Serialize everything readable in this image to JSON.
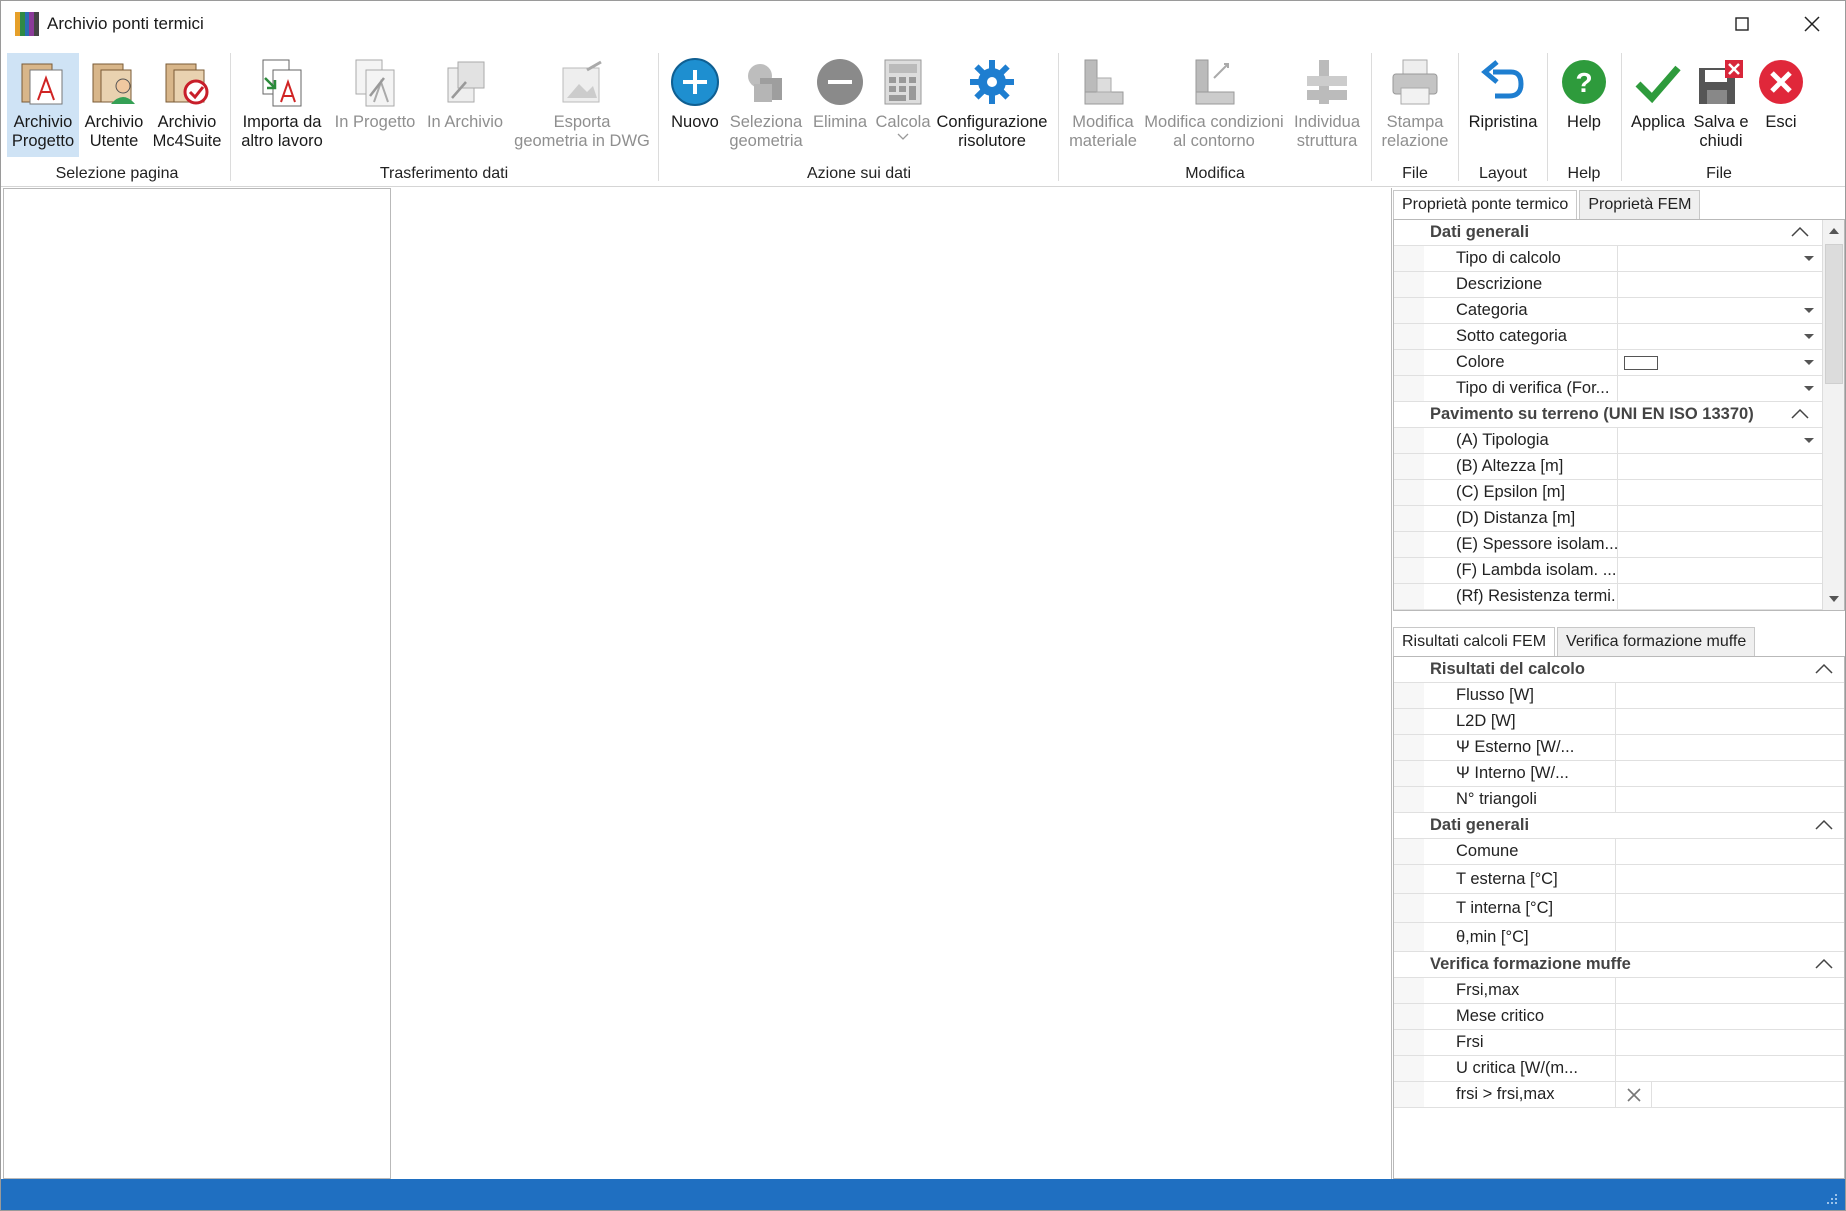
{
  "window": {
    "title": "Archivio ponti termici"
  },
  "ribbon": {
    "buttons": [
      {
        "label": "Archivio\nProgetto",
        "icon": "archive-project-icon"
      },
      {
        "label": "Archivio\nUtente",
        "icon": "archive-user-icon"
      },
      {
        "label": "Archivio\nMc4Suite",
        "icon": "archive-mc4suite-icon"
      },
      {
        "label": "Importa da\naltro lavoro",
        "icon": "import-icon"
      },
      {
        "label": "In Progetto",
        "icon": "to-project-icon"
      },
      {
        "label": "In Archivio",
        "icon": "to-archive-icon"
      },
      {
        "label": "Esporta\ngeometria in DWG",
        "icon": "export-dwg-icon"
      },
      {
        "label": "Nuovo",
        "icon": "plus-icon"
      },
      {
        "label": "Seleziona\ngeometria",
        "icon": "select-geometry-icon"
      },
      {
        "label": "Elimina",
        "icon": "minus-icon"
      },
      {
        "label": "Calcola",
        "icon": "calculator-icon"
      },
      {
        "label": "Configurazione\nrisolutore",
        "icon": "gear-icon"
      },
      {
        "label": "Modifica\nmateriale",
        "icon": "edit-material-icon"
      },
      {
        "label": "Modifica condizioni\nal contorno",
        "icon": "edit-boundary-icon"
      },
      {
        "label": "Individua\nstruttura",
        "icon": "find-structure-icon"
      },
      {
        "label": "Stampa\nrelazione",
        "icon": "printer-icon"
      },
      {
        "label": "Ripristina",
        "icon": "undo-icon"
      },
      {
        "label": "Help",
        "icon": "help-icon"
      },
      {
        "label": "Applica",
        "icon": "check-icon"
      },
      {
        "label": "Salva e\nchiudi",
        "icon": "save-close-icon"
      },
      {
        "label": "Esci",
        "icon": "exit-icon"
      }
    ],
    "groups": [
      "Selezione pagina",
      "Trasferimento dati",
      "Azione sui dati",
      "Modifica",
      "File",
      "Layout",
      "Help",
      "File"
    ]
  },
  "properties_panel": {
    "tabs": [
      "Proprietà ponte termico",
      "Proprietà FEM"
    ],
    "categories": [
      {
        "title": "Dati generali",
        "rows": [
          {
            "name": "Tipo di calcolo",
            "dropdown": true
          },
          {
            "name": "Descrizione"
          },
          {
            "name": "Categoria",
            "dropdown": true
          },
          {
            "name": "Sotto categoria",
            "dropdown": true
          },
          {
            "name": "Colore",
            "dropdown": true,
            "swatch": "#ffffff"
          },
          {
            "name": "Tipo di verifica (For...",
            "dropdown": true
          }
        ]
      },
      {
        "title": "Pavimento su terreno (UNI EN ISO 13370)",
        "rows": [
          {
            "name": "(A) Tipologia",
            "dropdown": true
          },
          {
            "name": "(B) Altezza [m]"
          },
          {
            "name": "(C) Epsilon [m]"
          },
          {
            "name": "(D) Distanza [m]"
          },
          {
            "name": "(E) Spessore isolam..."
          },
          {
            "name": "(F) Lambda isolam. ..."
          },
          {
            "name": "(Rf) Resistenza termi..."
          }
        ]
      }
    ]
  },
  "results_panel": {
    "tabs": [
      "Risultati calcoli FEM",
      "Verifica formazione muffe"
    ],
    "categories": [
      {
        "title": "Risultati del calcolo",
        "rows": [
          {
            "name": "Flusso [W]"
          },
          {
            "name": "L2D [W]"
          },
          {
            "name": "Ψ Esterno [W/..."
          },
          {
            "name": "Ψ Interno [W/..."
          },
          {
            "name": "N° triangoli"
          }
        ]
      },
      {
        "title": "Dati generali",
        "rows": [
          {
            "name": "Comune"
          },
          {
            "name": "T esterna [°C]"
          },
          {
            "name": "T interna [°C]"
          },
          {
            "name": "θ,min [°C]"
          }
        ]
      },
      {
        "title": "Verifica formazione muffe",
        "rows": [
          {
            "name": "Frsi,max"
          },
          {
            "name": "Mese critico"
          },
          {
            "name": "Frsi"
          },
          {
            "name": "U critica [W/(m..."
          },
          {
            "name": "frsi > frsi,max",
            "check": "unchecked"
          }
        ]
      }
    ]
  },
  "colors": {
    "accent": "#1f6fc1",
    "active_button_bg": "#cfe3f5",
    "status_bar": "#1f6fc1"
  }
}
